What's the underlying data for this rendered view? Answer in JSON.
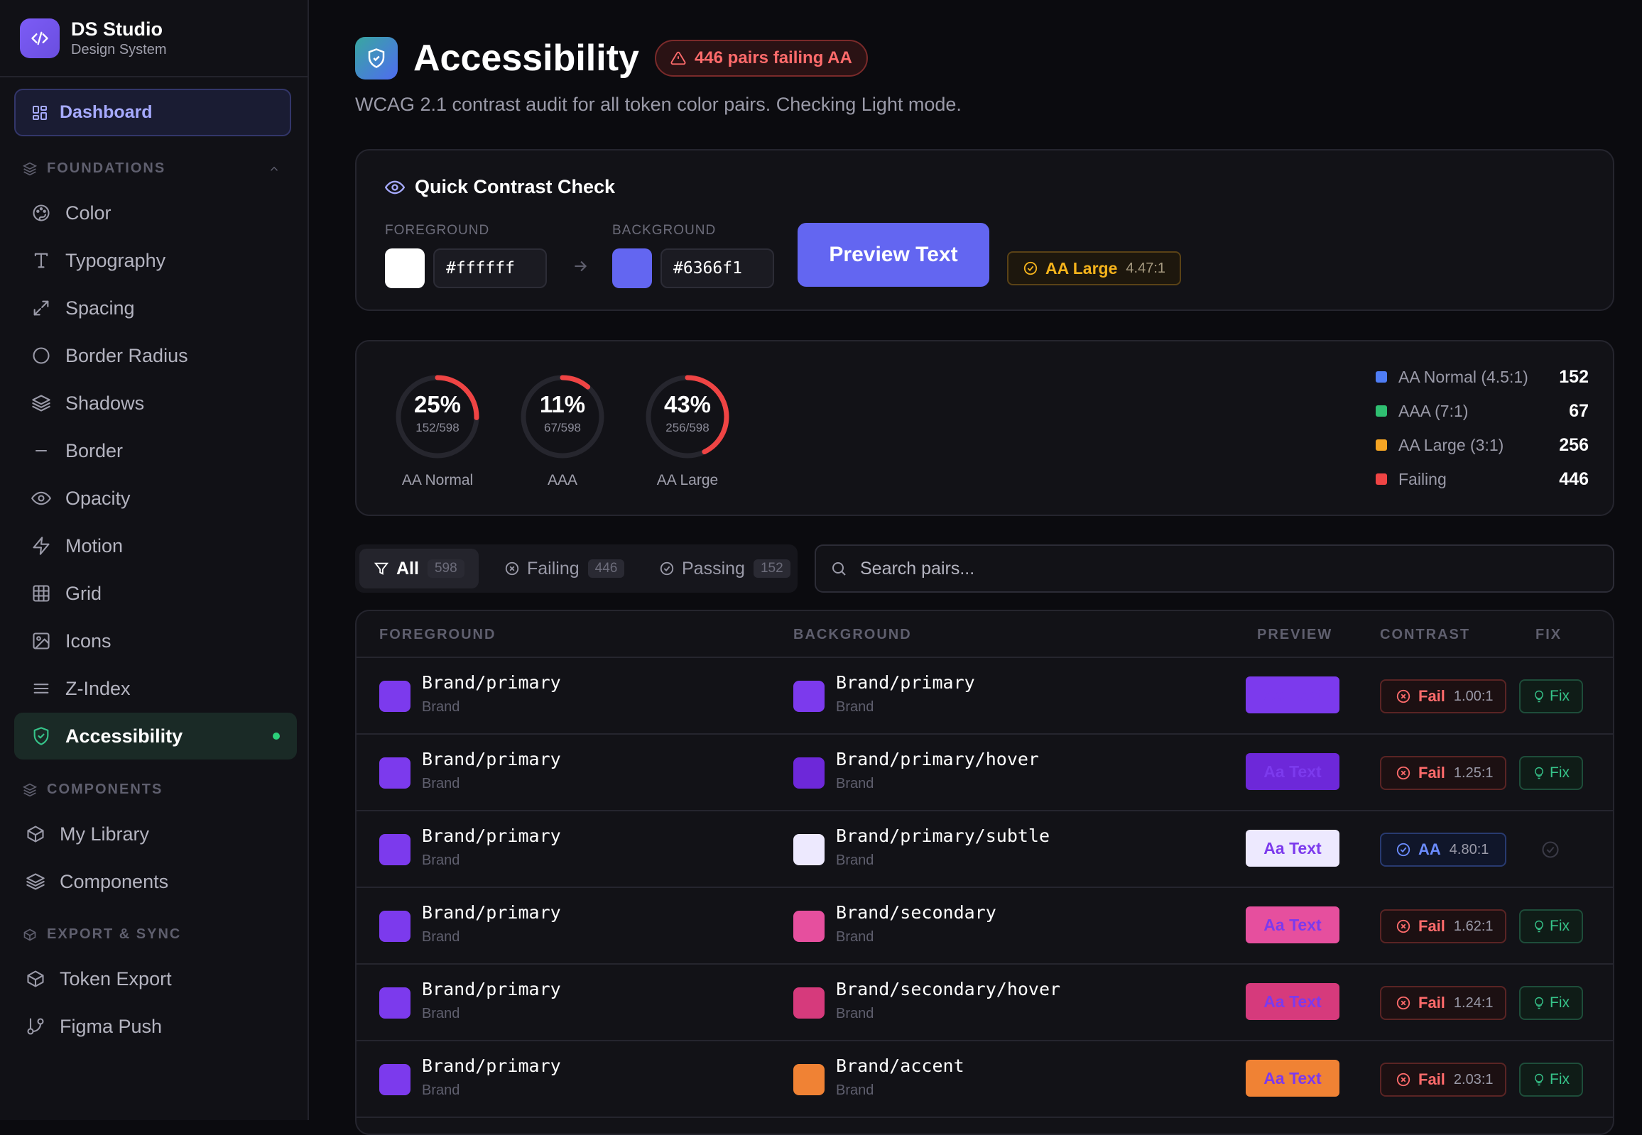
{
  "app": {
    "name": "DS Studio",
    "subtitle": "Design System"
  },
  "sidebar": {
    "dashboard_label": "Dashboard",
    "sections": {
      "foundations": "FOUNDATIONS",
      "components": "COMPONENTS",
      "export": "EXPORT & SYNC"
    },
    "foundations": [
      "Color",
      "Typography",
      "Spacing",
      "Border Radius",
      "Shadows",
      "Border",
      "Opacity",
      "Motion",
      "Grid",
      "Icons",
      "Z-Index",
      "Accessibility"
    ],
    "components": [
      "My Library",
      "Components"
    ],
    "export": [
      "Token Export",
      "Figma Push"
    ],
    "active_item": "Accessibility"
  },
  "header": {
    "title": "Accessibility",
    "badge": "446 pairs failing AA",
    "description": "WCAG 2.1 contrast audit for all token color pairs. Checking Light mode."
  },
  "quick_check": {
    "title": "Quick Contrast Check",
    "foreground_label": "FOREGROUND",
    "foreground_value": "#ffffff",
    "background_label": "BACKGROUND",
    "background_value": "#6366f1",
    "preview_label": "Preview Text",
    "result_level": "AA Large",
    "result_ratio": "4.47:1"
  },
  "stats": {
    "rings": [
      {
        "pct": "25%",
        "count": "152/598",
        "label": "AA Normal",
        "fraction": 0.254
      },
      {
        "pct": "11%",
        "count": "67/598",
        "label": "AAA",
        "fraction": 0.112
      },
      {
        "pct": "43%",
        "count": "256/598",
        "label": "AA Large",
        "fraction": 0.428
      }
    ],
    "legend": [
      {
        "name": "AA Normal (4.5:1)",
        "value": "152",
        "color": "#4f7df5"
      },
      {
        "name": "AAA (7:1)",
        "value": "67",
        "color": "#2fbf71"
      },
      {
        "name": "AA Large (3:1)",
        "value": "256",
        "color": "#f5a524"
      },
      {
        "name": "Failing",
        "value": "446",
        "color": "#ef4444"
      }
    ]
  },
  "filters": {
    "tabs": [
      {
        "label": "All",
        "count": "598"
      },
      {
        "label": "Failing",
        "count": "446"
      },
      {
        "label": "Passing",
        "count": "152"
      }
    ],
    "search_placeholder": "Search pairs..."
  },
  "table": {
    "headers": {
      "foreground": "FOREGROUND",
      "background": "BACKGROUND",
      "preview": "PREVIEW",
      "contrast": "CONTRAST",
      "fix": "FIX"
    },
    "fix_label": "Fix",
    "preview_text": "Aa Text",
    "rows": [
      {
        "fg": "Brand/primary",
        "fg_group": "Brand",
        "fg_color": "#7c3aed",
        "bg": "Brand/primary",
        "bg_group": "Brand",
        "bg_color": "#7c3aed",
        "status": "Fail",
        "ratio": "1.00:1",
        "pass": false
      },
      {
        "fg": "Brand/primary",
        "fg_group": "Brand",
        "fg_color": "#7c3aed",
        "bg": "Brand/primary/hover",
        "bg_group": "Brand",
        "bg_color": "#6d28d9",
        "status": "Fail",
        "ratio": "1.25:1",
        "pass": false
      },
      {
        "fg": "Brand/primary",
        "fg_group": "Brand",
        "fg_color": "#7c3aed",
        "bg": "Brand/primary/subtle",
        "bg_group": "Brand",
        "bg_color": "#ede9fe",
        "status": "AA",
        "ratio": "4.80:1",
        "pass": true
      },
      {
        "fg": "Brand/primary",
        "fg_group": "Brand",
        "fg_color": "#7c3aed",
        "bg": "Brand/secondary",
        "bg_group": "Brand",
        "bg_color": "#e64f9e",
        "status": "Fail",
        "ratio": "1.62:1",
        "pass": false
      },
      {
        "fg": "Brand/primary",
        "fg_group": "Brand",
        "fg_color": "#7c3aed",
        "bg": "Brand/secondary/hover",
        "bg_group": "Brand",
        "bg_color": "#d63a7c",
        "status": "Fail",
        "ratio": "1.24:1",
        "pass": false
      },
      {
        "fg": "Brand/primary",
        "fg_group": "Brand",
        "fg_color": "#7c3aed",
        "bg": "Brand/accent",
        "bg_group": "Brand",
        "bg_color": "#f08234",
        "status": "Fail",
        "ratio": "2.03:1",
        "pass": false
      }
    ]
  }
}
